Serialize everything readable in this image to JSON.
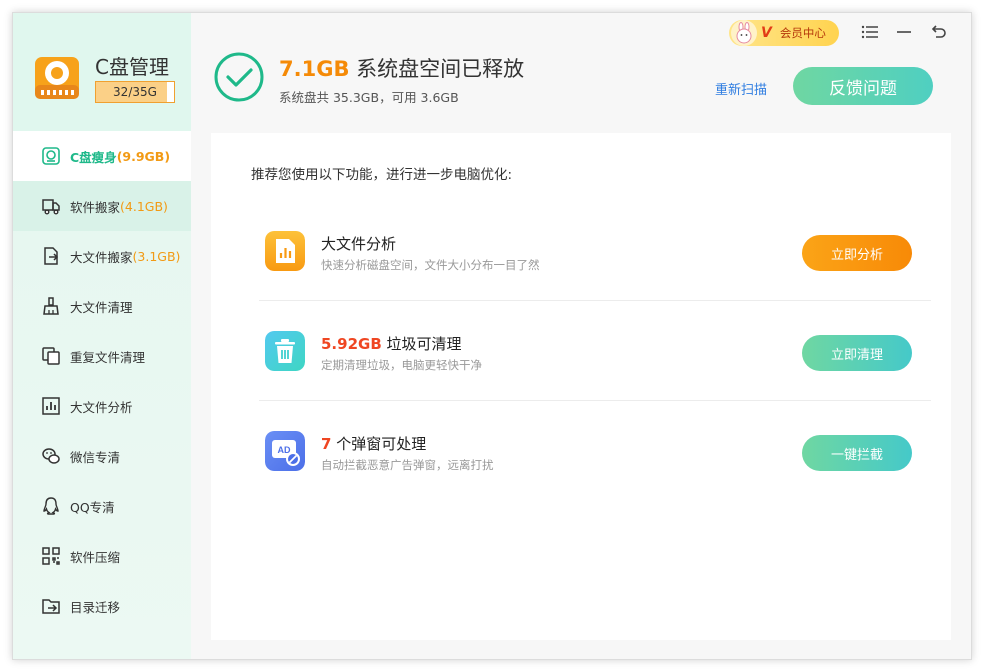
{
  "app": {
    "title": "C盘管理",
    "disk_usage_text": "32/35G",
    "disk_usage_fraction": 0.914
  },
  "sidebar": {
    "items": [
      {
        "label": "C盘瘦身",
        "size": "(9.9GB)",
        "icon": "disk-slim-icon"
      },
      {
        "label": "软件搬家",
        "size": "(4.1GB)",
        "icon": "truck-icon"
      },
      {
        "label": "大文件搬家",
        "size": "(3.1GB)",
        "icon": "file-move-icon"
      },
      {
        "label": "大文件清理",
        "size": "",
        "icon": "broom-icon"
      },
      {
        "label": "重复文件清理",
        "size": "",
        "icon": "duplicate-icon"
      },
      {
        "label": "大文件分析",
        "size": "",
        "icon": "chart-icon"
      },
      {
        "label": "微信专清",
        "size": "",
        "icon": "wechat-icon"
      },
      {
        "label": "QQ专清",
        "size": "",
        "icon": "qq-icon"
      },
      {
        "label": "软件压缩",
        "size": "",
        "icon": "compress-icon"
      },
      {
        "label": "目录迁移",
        "size": "",
        "icon": "folder-move-icon"
      }
    ]
  },
  "header": {
    "freed_amount": "7.1GB",
    "freed_text": " 系统盘空间已释放",
    "subline": "系统盘共 35.3GB，可用 3.6GB",
    "rescan_label": "重新扫描",
    "feedback_label": "反馈问题",
    "vip_badge": "V",
    "vip_label": "会员中心"
  },
  "content": {
    "intro": "推荐您使用以下功能，进行进一步电脑优化:",
    "features": [
      {
        "highlight": "",
        "title": "大文件分析",
        "desc": "快速分析磁盘空间，文件大小分布一目了然",
        "button": "立即分析",
        "icon": "file-chart-icon"
      },
      {
        "highlight": "5.92GB",
        "title": " 垃圾可清理",
        "desc": "定期清理垃圾，电脑更轻快干净",
        "button": "立即清理",
        "icon": "trash-icon"
      },
      {
        "highlight": "7",
        "title": " 个弹窗可处理",
        "desc": "自动拦截恶意广告弹窗，远离打扰",
        "button": "一键拦截",
        "icon": "ad-block-icon"
      }
    ]
  },
  "colors": {
    "accent_green": "#1fb98a",
    "accent_orange": "#f58a07",
    "highlight_red": "#ef4622",
    "link_blue": "#2f7de1"
  }
}
